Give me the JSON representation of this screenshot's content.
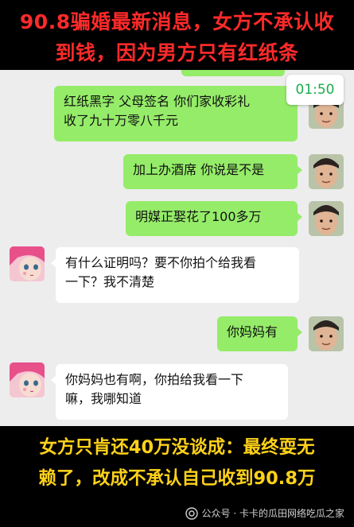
{
  "top_banner": {
    "line1": "90.8骗婚最新消息，女方不承认收",
    "line2": "到钱，因为男方只有红纸条"
  },
  "timer": "01:50",
  "messages": [
    {
      "side": "right",
      "text_lines": [
        "红纸黑字 父母签名 你们家收彩礼",
        "收了九十万零八千元"
      ]
    },
    {
      "side": "right",
      "text": "加上办酒席 你说是不是"
    },
    {
      "side": "right",
      "text": "明媒正娶花了100多万"
    },
    {
      "side": "left",
      "text_lines": [
        "有什么证明吗？要不你拍个给我看",
        "一下？我不清楚"
      ]
    },
    {
      "side": "right",
      "text": "你妈妈有"
    },
    {
      "side": "left",
      "text_lines": [
        "你妈妈也有啊，你拍给我看一下",
        "嘛，我哪知道"
      ]
    }
  ],
  "bottom_banner": {
    "line1": "女方只肯还40万没谈成：最终耍无",
    "line2": "赖了，改成不承认自己收到90.8万"
  },
  "watermark": {
    "text": "公众号 · 卡卡的瓜田网络吃瓜之家",
    "icon": "wechat-official-account-icon"
  },
  "colors": {
    "top_text": "#ff2a2a",
    "bottom_text": "#ffd21a",
    "right_bubble": "#95ec69",
    "left_bubble": "#ffffff",
    "timer_text": "#1aad4a",
    "chat_background": "#ededed"
  }
}
